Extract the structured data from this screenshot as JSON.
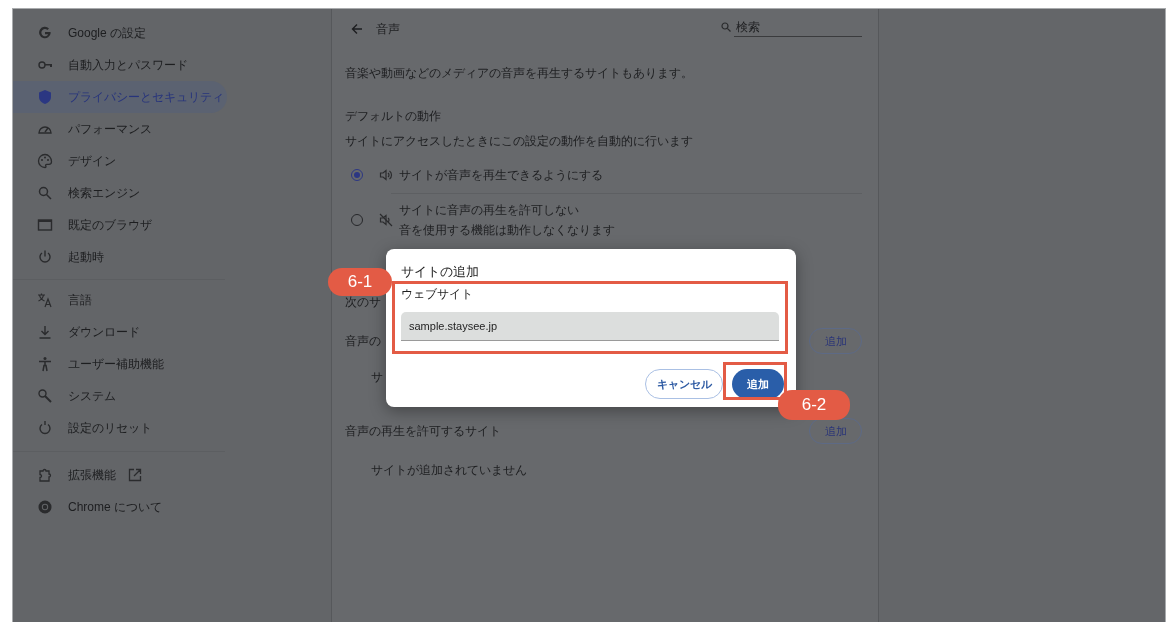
{
  "sidebar": {
    "groups": [
      {
        "items": [
          {
            "label": "Google の設定",
            "selected": false
          },
          {
            "label": "自動入力とパスワード",
            "selected": false
          },
          {
            "label": "プライバシーとセキュリティ",
            "selected": true
          },
          {
            "label": "パフォーマンス",
            "selected": false
          },
          {
            "label": "デザイン",
            "selected": false
          },
          {
            "label": "検索エンジン",
            "selected": false
          },
          {
            "label": "既定のブラウザ",
            "selected": false
          },
          {
            "label": "起動時",
            "selected": false
          }
        ]
      },
      {
        "items": [
          {
            "label": "言語",
            "selected": false
          },
          {
            "label": "ダウンロード",
            "selected": false
          },
          {
            "label": "ユーザー補助機能",
            "selected": false
          },
          {
            "label": "システム",
            "selected": false
          },
          {
            "label": "設定のリセット",
            "selected": false
          }
        ]
      },
      {
        "items": [
          {
            "label": "拡張機能",
            "selected": false,
            "external": true
          },
          {
            "label": "Chrome について",
            "selected": false
          }
        ]
      }
    ]
  },
  "main": {
    "title": "音声",
    "search_placeholder": "検索",
    "description": "音楽や動画などのメディアの音声を再生するサイトもあります。",
    "default_behavior": {
      "heading": "デフォルトの動作",
      "subtext": "サイトにアクセスしたときにこの設定の動作を自動的に行います",
      "options": [
        {
          "kind": "sound",
          "label": "サイトが音声を再生できるようにする",
          "selected": true
        },
        {
          "kind": "muted",
          "label": "サイトに音声の再生を許可しない",
          "sublabel": "音を使用する機能は動作しなくなります",
          "selected": false
        }
      ]
    },
    "sections": [
      {
        "heading": "次のサ"
      },
      {
        "heading": "音声の",
        "button": "追加",
        "empty": "サ"
      },
      {
        "heading": "音声の再生を許可するサイト",
        "button": "追加",
        "empty": "サイトが追加されていません"
      }
    ]
  },
  "dialog": {
    "title": "サイトの追加",
    "field_label": "ウェブサイト",
    "value": "sample.staysee.jp",
    "buttons": [
      {
        "label": "キャンセル",
        "kind": "secondary"
      },
      {
        "label": "追加",
        "kind": "primary"
      }
    ]
  },
  "annotations": [
    {
      "label": "6-1"
    },
    {
      "label": "6-2"
    }
  ]
}
